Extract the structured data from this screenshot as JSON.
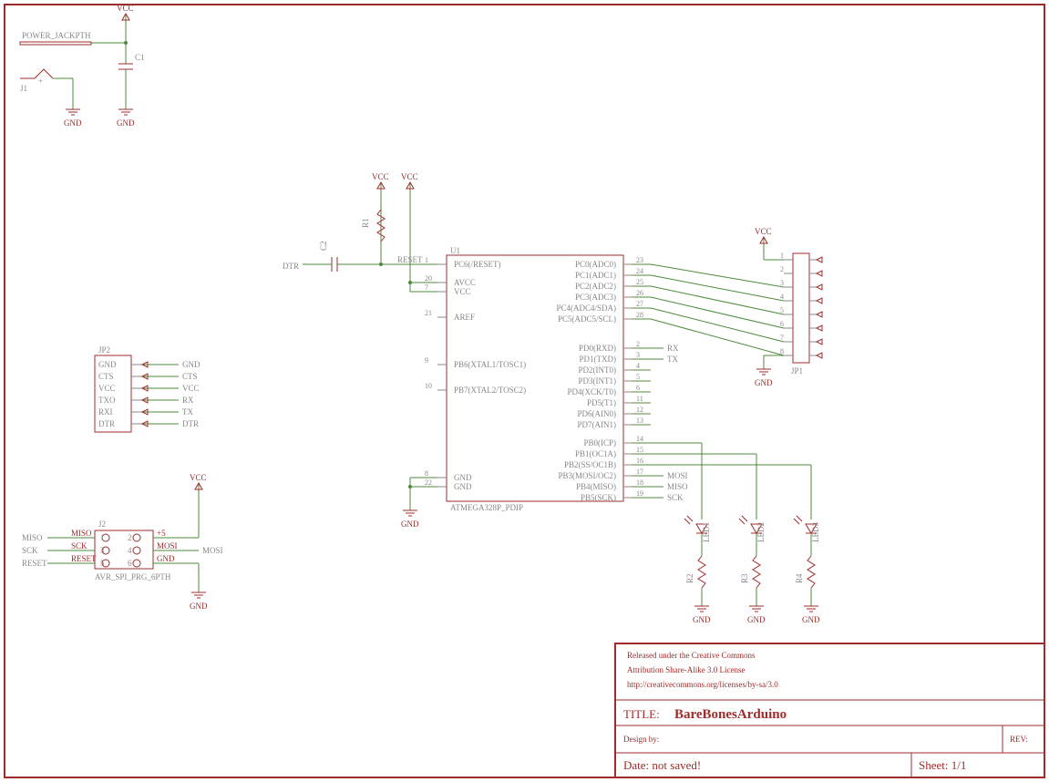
{
  "license": {
    "line1": "Released under the Creative Commons",
    "line2": "Attribution Share-Alike 3.0 License",
    "line3": "http://creativecommons.org/licenses/by-sa/3.0"
  },
  "titleblock": {
    "title_label": "TITLE:",
    "title": "BareBonesArduino",
    "design_by": "Design by:",
    "rev": "REV:",
    "date": "Date: not saved!",
    "sheet": "Sheet: 1/1"
  },
  "power_jack": {
    "name": "POWER_JACKPTH",
    "ref": "J1",
    "vcc": "VCC",
    "gnd1": "GND",
    "gnd2": "GND",
    "cap_ref": "C1",
    "plus": "+"
  },
  "ic": {
    "ref": "U1",
    "value": "ATMEGA328P_PDIP",
    "vcc1": "VCC",
    "vcc2": "VCC",
    "gnd": "GND",
    "dtr_net": "DTR",
    "reset_net": "RESET",
    "c2": "C2",
    "r1": "R1",
    "left_pins": [
      {
        "num": "1",
        "name": "PC6(/RESET)"
      },
      {
        "num": "20",
        "name": "AVCC"
      },
      {
        "num": "7",
        "name": "VCC"
      },
      {
        "num": "21",
        "name": "AREF"
      },
      {
        "num": "9",
        "name": "PB6(XTAL1/TOSC1)"
      },
      {
        "num": "10",
        "name": "PB7(XTAL2/TOSC2)"
      },
      {
        "num": "8",
        "name": "GND"
      },
      {
        "num": "22",
        "name": "GND"
      }
    ],
    "right_pins": [
      {
        "num": "23",
        "name": "PC0(ADC0)"
      },
      {
        "num": "24",
        "name": "PC1(ADC1)"
      },
      {
        "num": "25",
        "name": "PC2(ADC2)"
      },
      {
        "num": "26",
        "name": "PC3(ADC3)"
      },
      {
        "num": "27",
        "name": "PC4(ADC4/SDA)"
      },
      {
        "num": "28",
        "name": "PC5(ADC5/SCL)"
      },
      {
        "num": "2",
        "name": "PD0(RXD)",
        "net": "RX"
      },
      {
        "num": "3",
        "name": "PD1(TXD)",
        "net": "TX"
      },
      {
        "num": "4",
        "name": "PD2(INT0)"
      },
      {
        "num": "5",
        "name": "PD3(INT1)"
      },
      {
        "num": "6",
        "name": "PD4(XCK/T0)"
      },
      {
        "num": "11",
        "name": "PD5(T1)"
      },
      {
        "num": "12",
        "name": "PD6(AIN0)"
      },
      {
        "num": "13",
        "name": "PD7(AIN1)"
      },
      {
        "num": "14",
        "name": "PB0(ICP)"
      },
      {
        "num": "15",
        "name": "PB1(OC1A)"
      },
      {
        "num": "16",
        "name": "PB2(SS/OC1B)"
      },
      {
        "num": "17",
        "name": "PB3(MOSI/OC2)",
        "net": "MOSI"
      },
      {
        "num": "18",
        "name": "PB4(MISO)",
        "net": "MISO"
      },
      {
        "num": "19",
        "name": "PB5(SCK)",
        "net": "SCK"
      }
    ]
  },
  "jp1": {
    "ref": "JP1",
    "vcc": "VCC",
    "gnd": "GND",
    "pins": [
      "1",
      "2",
      "3",
      "4",
      "5",
      "6",
      "7",
      "8"
    ]
  },
  "jp2": {
    "ref": "JP2",
    "rows": [
      {
        "label": "GND",
        "net": "GND"
      },
      {
        "label": "CTS",
        "net": "CTS"
      },
      {
        "label": "VCC",
        "net": "VCC"
      },
      {
        "label": "TXO",
        "net": "RX"
      },
      {
        "label": "RXI",
        "net": "TX"
      },
      {
        "label": "DTR",
        "net": "DTR"
      }
    ]
  },
  "isp": {
    "ref": "J2",
    "value": "AVR_SPI_PRG_6PTH",
    "vcc": "VCC",
    "gnd": "GND",
    "left": [
      {
        "net": "MISO",
        "label": "MISO",
        "row": "1"
      },
      {
        "net": "SCK",
        "label": "SCK",
        "row": "3"
      },
      {
        "net": "RESET",
        "label": "RESET",
        "row": "5"
      }
    ],
    "right": [
      {
        "label": "+5",
        "row": "2"
      },
      {
        "net": "MOSI",
        "label": "MOSI",
        "row": "4"
      },
      {
        "label": "GND",
        "row": "6"
      }
    ]
  },
  "leds": [
    {
      "ref": "LED1",
      "r": "R2",
      "gnd": "GND"
    },
    {
      "ref": "LED2",
      "r": "R3",
      "gnd": "GND"
    },
    {
      "ref": "LED3",
      "r": "R4",
      "gnd": "GND"
    }
  ]
}
